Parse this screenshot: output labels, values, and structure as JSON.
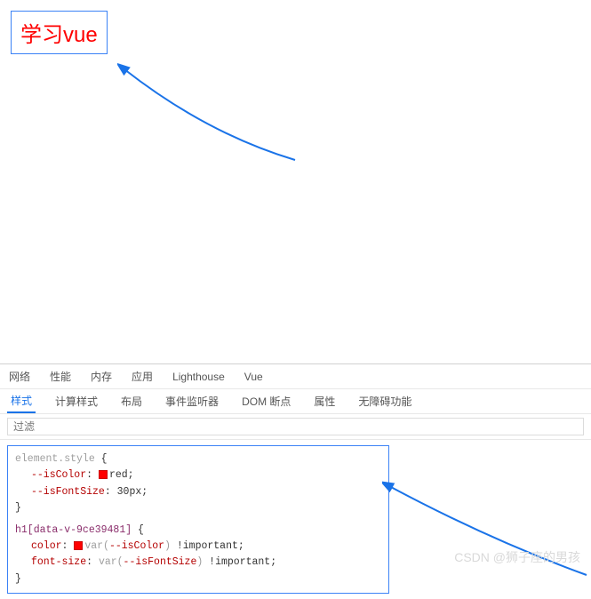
{
  "rendered": {
    "heading": "学习vue"
  },
  "devtools": {
    "tabs": [
      "网络",
      "性能",
      "内存",
      "应用",
      "Lighthouse",
      "Vue"
    ],
    "subtabs": [
      "样式",
      "计算样式",
      "布局",
      "事件监听器",
      "DOM 断点",
      "属性",
      "无障碍功能"
    ],
    "active_subtab": "样式",
    "filter_placeholder": "过滤"
  },
  "styles": {
    "rule1": {
      "selector": "element.style",
      "open": "{",
      "props": [
        {
          "name": "--isColor",
          "swatch": "#ff0000",
          "value": "red",
          "suffix": ";"
        },
        {
          "name": "--isFontSize",
          "value": "30px",
          "suffix": ";"
        }
      ],
      "close": "}"
    },
    "rule2": {
      "selector": "h1[data-v-9ce39481]",
      "open": "{",
      "props": [
        {
          "name": "color",
          "swatch": "#ff0000",
          "value_func": "var(",
          "value_arg": "--isColor",
          "value_func_close": ")",
          "important": " !important",
          "suffix": ";"
        },
        {
          "name": "font-size",
          "value_func": "var(",
          "value_arg": "--isFontSize",
          "value_func_close": ")",
          "important": " !important",
          "suffix": ";"
        }
      ],
      "close": "}"
    }
  },
  "watermark": "CSDN @狮子座的男孩"
}
